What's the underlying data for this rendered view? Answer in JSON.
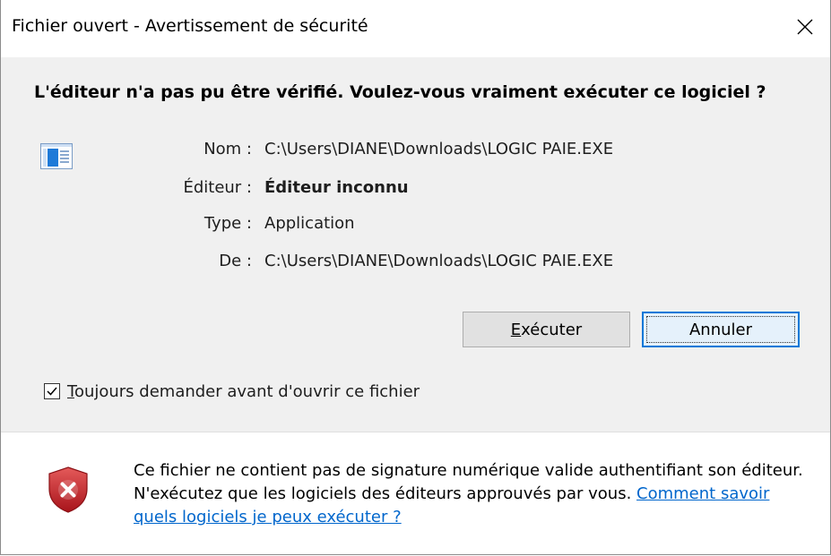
{
  "window": {
    "title": "Fichier ouvert - Avertissement de sécurité"
  },
  "dialog": {
    "heading": "L'éditeur n'a pas pu être vérifié. Voulez-vous vraiment exécuter ce logiciel ?",
    "app_icon": "application-window-icon",
    "fields": {
      "name_label": "Nom :",
      "name_value": "C:\\Users\\DIANE\\Downloads\\LOGIC PAIE.EXE",
      "publisher_label": "Éditeur :",
      "publisher_value": "Éditeur inconnu",
      "type_label": "Type :",
      "type_value": "Application",
      "from_label": "De :",
      "from_value": "C:\\Users\\DIANE\\Downloads\\LOGIC PAIE.EXE"
    },
    "buttons": {
      "run_accel": "E",
      "run_rest": "xécuter",
      "cancel": "Annuler"
    },
    "checkbox": {
      "checked": true,
      "label_accel": "T",
      "label_rest": "oujours demander avant d'ouvrir ce fichier"
    }
  },
  "warning": {
    "icon": "shield-error-icon",
    "text": "Ce fichier ne contient pas de signature numérique valide authentifiant son éditeur. N'exécutez que les logiciels des éditeurs approuvés par vous.",
    "link": "Comment savoir quels logiciels je peux exécuter ?"
  },
  "colors": {
    "accent": "#0078d7",
    "link": "#0066cc",
    "shield_red": "#c1272d"
  }
}
